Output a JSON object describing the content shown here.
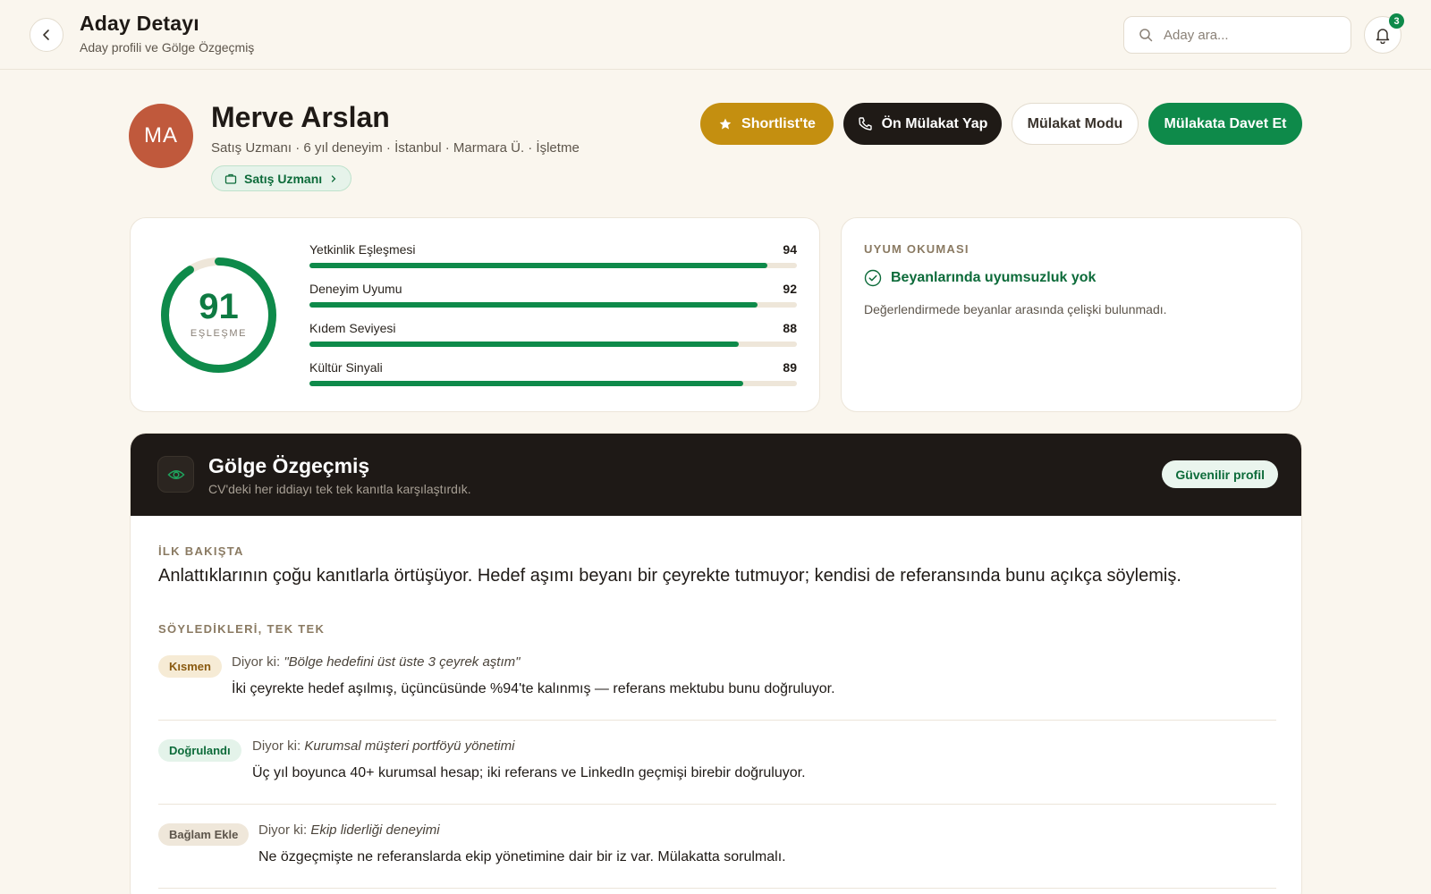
{
  "header": {
    "title": "Aday Detayı",
    "subtitle": "Aday profili ve Gölge Özgeçmiş",
    "search_placeholder": "Aday ara...",
    "notification_count": "3"
  },
  "candidate": {
    "initials": "MA",
    "name": "Merve Arslan",
    "meta": "Satış Uzmanı · 6 yıl deneyim · İstanbul · Marmara Ü. · İşletme",
    "role_chip": "Satış Uzmanı"
  },
  "actions": {
    "shortlist": "Shortlist'te",
    "pre_interview": "Ön Mülakat Yap",
    "interview_mode": "Mülakat Modu",
    "invite": "Mülakata Davet Et"
  },
  "score": {
    "value": "91",
    "value_fraction": 0.91,
    "label": "EŞLEŞME",
    "metrics": [
      {
        "label": "Yetkinlik Eşleşmesi",
        "value": "94",
        "fraction": 0.94
      },
      {
        "label": "Deneyim Uyumu",
        "value": "92",
        "fraction": 0.92
      },
      {
        "label": "Kıdem Seviyesi",
        "value": "88",
        "fraction": 0.88
      },
      {
        "label": "Kültür Sinyali",
        "value": "89",
        "fraction": 0.89
      }
    ]
  },
  "uyum": {
    "title": "UYUM OKUMASI",
    "status": "Beyanlarında uyumsuzluk yok",
    "description": "Değerlendirmede beyanlar arasında çelişki bulunmadı."
  },
  "shadow_resume": {
    "title": "Gölge Özgeçmiş",
    "subtitle": "CV'deki her iddiayı tek tek kanıtla karşılaştırdık.",
    "trust_badge": "Güvenilir profil",
    "glance_label": "İLK BAKIŞTA",
    "summary": "Anlattıklarının çoğu kanıtlarla örtüşüyor. Hedef aşımı beyanı bir çeyrekte tutmuyor; kendisi de referansında bunu açıkça söylemiş.",
    "claims_label": "SÖYLEDİKLERİ, TEK TEK",
    "says_prefix": "Diyor ki:",
    "claims": [
      {
        "badge": "Kısmen",
        "quote": "\"Bölge hedefini üst üste 3 çeyrek aştım\"",
        "evidence": "İki çeyrekte hedef aşılmış, üçüncüsünde %94'te kalınmış — referans mektubu bunu doğruluyor."
      },
      {
        "badge": "Doğrulandı",
        "quote": "Kurumsal müşteri portföyü yönetimi",
        "evidence": "Üç yıl boyunca 40+ kurumsal hesap; iki referans ve LinkedIn geçmişi birebir doğruluyor."
      },
      {
        "badge": "Bağlam Ekle",
        "quote": "Ekip liderliği deneyimi",
        "evidence": "Ne özgeçmişte ne referanslarda ekip yönetimine dair bir iz var. Mülakatta sorulmalı."
      }
    ]
  }
}
